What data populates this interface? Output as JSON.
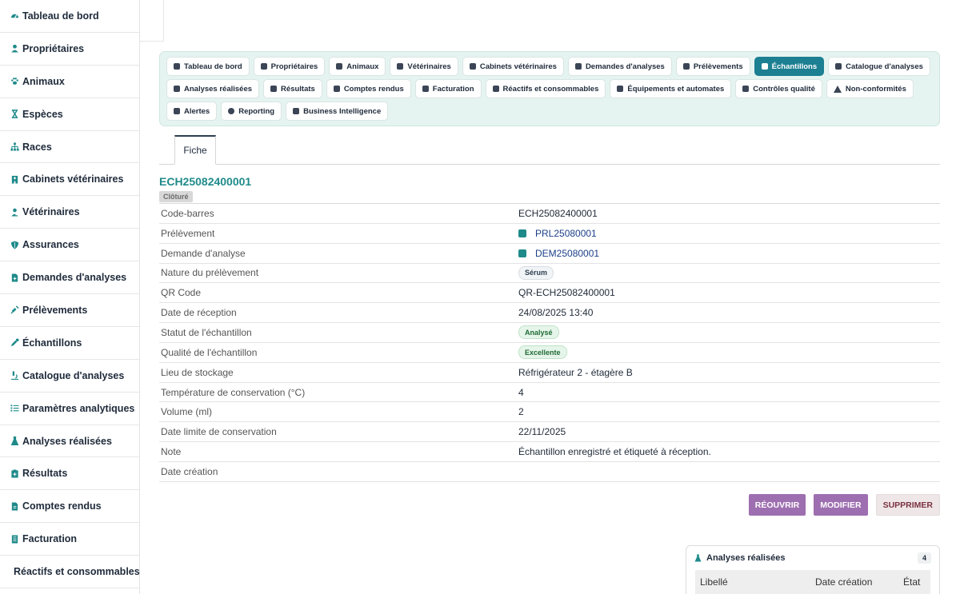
{
  "sidebar": {
    "items": [
      {
        "label": "Tableau de bord",
        "icon": "dashboard-icon"
      },
      {
        "label": "Propriétaires",
        "icon": "user-icon"
      },
      {
        "label": "Animaux",
        "icon": "paw-icon"
      },
      {
        "label": "Espèces",
        "icon": "hourglass-icon"
      },
      {
        "label": "Races",
        "icon": "sitemap-icon"
      },
      {
        "label": "Cabinets vétérinaires",
        "icon": "hospital-icon"
      },
      {
        "label": "Vétérinaires",
        "icon": "doctor-icon"
      },
      {
        "label": "Assurances",
        "icon": "shield-icon"
      },
      {
        "label": "Demandes d'analyses",
        "icon": "file-medical-icon"
      },
      {
        "label": "Prélèvements",
        "icon": "syringe-icon"
      },
      {
        "label": "Échantillons",
        "icon": "eyedropper-icon"
      },
      {
        "label": "Catalogue d'analyses",
        "icon": "microscope-icon"
      },
      {
        "label": "Paramètres analytiques",
        "icon": "list-icon"
      },
      {
        "label": "Analyses réalisées",
        "icon": "flask-icon"
      },
      {
        "label": "Résultats",
        "icon": "notes-medical-icon"
      },
      {
        "label": "Comptes rendus",
        "icon": "file-icon"
      },
      {
        "label": "Facturation",
        "icon": "invoice-icon"
      },
      {
        "label": "Réactifs et consommables",
        "icon": "cubes-icon"
      }
    ]
  },
  "modules": {
    "row1": [
      {
        "label": "Tableau de bord"
      },
      {
        "label": "Propriétaires"
      },
      {
        "label": "Animaux"
      },
      {
        "label": "Vétérinaires"
      },
      {
        "label": "Cabinets vétérinaires"
      },
      {
        "label": "Demandes d'analyses"
      },
      {
        "label": "Prélèvements"
      },
      {
        "label": "Échantillons",
        "active": true
      },
      {
        "label": "Catalogue d'analyses"
      }
    ],
    "row2": [
      {
        "label": "Analyses réalisées"
      },
      {
        "label": "Résultats"
      },
      {
        "label": "Comptes rendus"
      },
      {
        "label": "Facturation"
      },
      {
        "label": "Réactifs et consommables"
      },
      {
        "label": "Équipements et automates"
      },
      {
        "label": "Contrôles qualité"
      },
      {
        "label": "Non-conformités"
      }
    ],
    "row3": [
      {
        "label": "Alertes"
      },
      {
        "label": "Reporting"
      },
      {
        "label": "Business Intelligence"
      }
    ]
  },
  "tabs": {
    "fiche": "Fiche"
  },
  "record": {
    "title": "ECH25082400001",
    "status": "Clôturé",
    "fields": {
      "code_barres": {
        "label": "Code-barres",
        "value": "ECH25082400001"
      },
      "prelevement": {
        "label": "Prélèvement",
        "value": "PRL25080001"
      },
      "demande": {
        "label": "Demande d'analyse",
        "value": "DEM25080001"
      },
      "nature": {
        "label": "Nature du prélèvement",
        "value": "Sérum"
      },
      "qr_code": {
        "label": "QR Code",
        "value": "QR-ECH25082400001"
      },
      "date_reception": {
        "label": "Date de réception",
        "value": "24/08/2025 13:40"
      },
      "statut": {
        "label": "Statut de l'échantillon",
        "value": "Analysé"
      },
      "qualite": {
        "label": "Qualité de l'échantillon",
        "value": "Excellente"
      },
      "lieu": {
        "label": "Lieu de stockage",
        "value": "Réfrigérateur 2 - étagère B"
      },
      "temperature": {
        "label": "Température de conservation (°C)",
        "value": "4"
      },
      "volume": {
        "label": "Volume (ml)",
        "value": "2"
      },
      "date_limite": {
        "label": "Date limite de conservation",
        "value": "22/11/2025"
      },
      "note": {
        "label": "Note",
        "value": "Échantillon enregistré et étiqueté à réception."
      },
      "date_creation": {
        "label": "Date création",
        "value": ""
      }
    }
  },
  "actions": {
    "reopen": "RÉOUVRIR",
    "edit": "MODIFIER",
    "delete": "SUPPRIMER"
  },
  "analyses_card": {
    "title": "Analyses réalisées",
    "count": "4",
    "columns": {
      "libelle": "Libellé",
      "date": "Date création",
      "etat": "État"
    }
  },
  "colors": {
    "accent": "#1f8a8a",
    "active_tab": "#1c7f92",
    "action_purple": "#9e6fb0"
  }
}
